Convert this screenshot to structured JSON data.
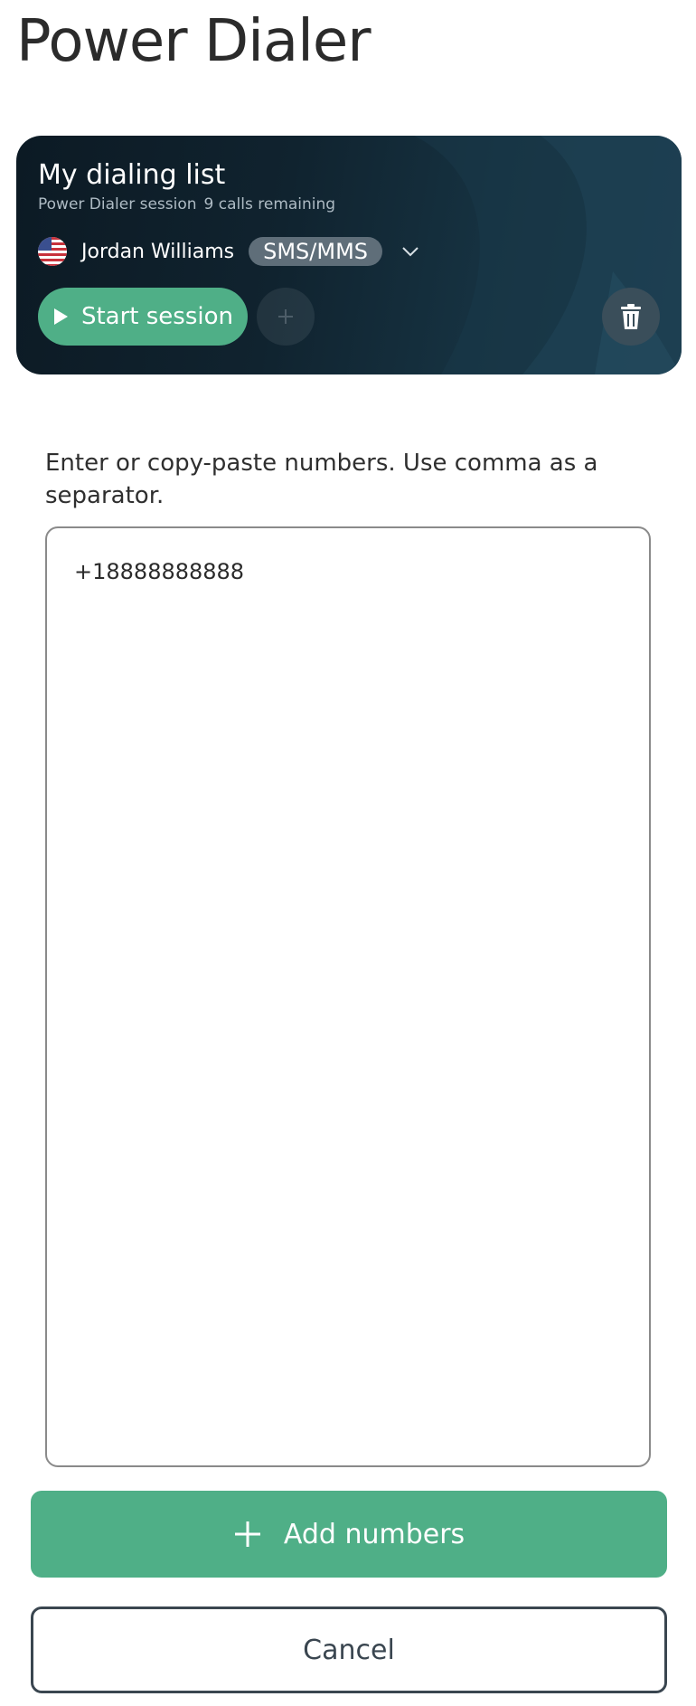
{
  "page": {
    "title": "Power Dialer"
  },
  "list_card": {
    "title": "My dialing list",
    "session_label": "Power Dialer session",
    "calls_remaining": "9 calls remaining",
    "caller": {
      "flag": "us-flag-icon",
      "name": "Jordan Williams",
      "channel": "SMS/MMS"
    },
    "start_label": "Start session",
    "colors": {
      "accent": "#4faf87",
      "card_bg": "#10232f"
    }
  },
  "numbers_input": {
    "instruction": "Enter or copy-paste numbers. Use comma as a separator.",
    "value": "+18888888888"
  },
  "actions": {
    "add_label": "Add numbers",
    "cancel_label": "Cancel"
  }
}
